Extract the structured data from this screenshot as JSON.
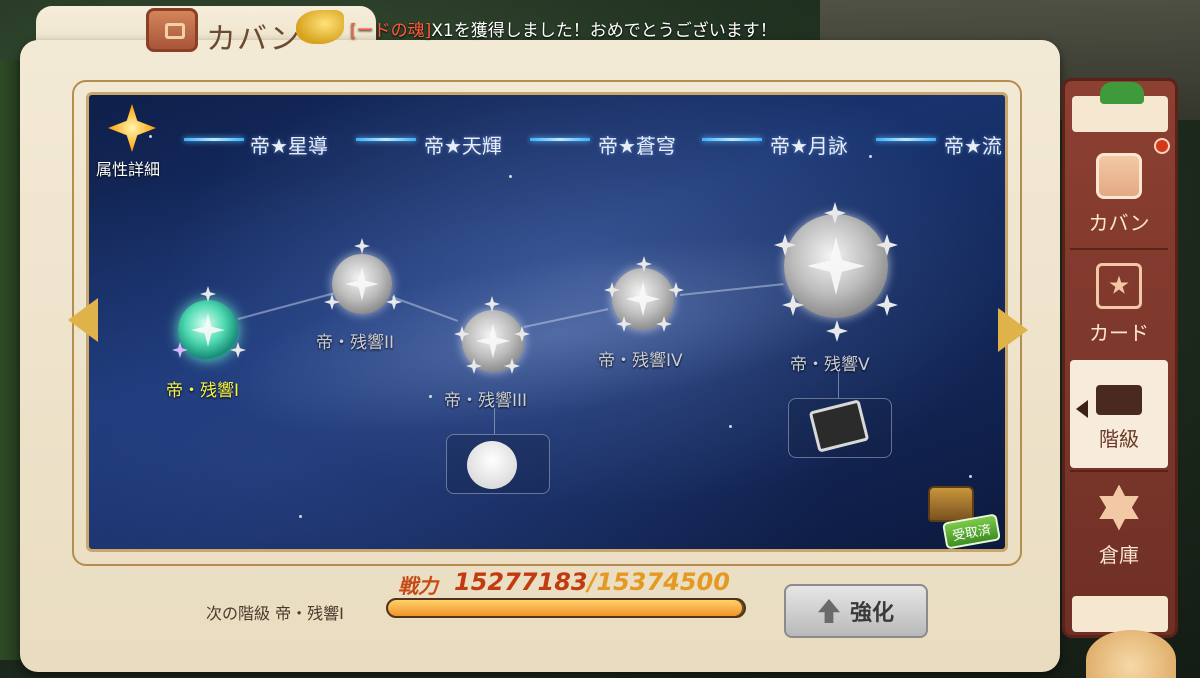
{
  "header": {
    "title": "カバン",
    "notice_highlight": "[ードの魂]",
    "notice_text": "X1を獲得しました！おめでとうございます！"
  },
  "attribute": {
    "label": "属性詳細"
  },
  "tiers": [
    "帝★星導",
    "帝★天輝",
    "帝★蒼穹",
    "帝★月詠",
    "帝★流"
  ],
  "nodes": [
    {
      "label": "帝・残響I",
      "state": "active"
    },
    {
      "label": "帝・残響II",
      "state": "locked"
    },
    {
      "label": "帝・残響III",
      "state": "locked"
    },
    {
      "label": "帝・残響IV",
      "state": "locked"
    },
    {
      "label": "帝・残響V",
      "state": "locked"
    }
  ],
  "rewards": {
    "chest_badge": "受取済"
  },
  "bottom": {
    "next_tier": "次の階級 帝・残響I",
    "power_label": "戦力",
    "power_current": "15277183",
    "power_max": "/15374500",
    "power_progress": 0.9937,
    "enhance_label": "強化"
  },
  "sidebar": {
    "items": [
      {
        "label": "カバン",
        "icon": "bag-icon",
        "active": false
      },
      {
        "label": "カード",
        "icon": "card-icon",
        "active": false
      },
      {
        "label": "階級",
        "icon": "scroll-icon",
        "active": true
      },
      {
        "label": "倉庫",
        "icon": "hexagram-icon",
        "active": false
      }
    ]
  },
  "colors": {
    "active_node_label": "#f5f24a",
    "power_value": "#c23b10",
    "sidebar_bg": "#8c4032"
  }
}
